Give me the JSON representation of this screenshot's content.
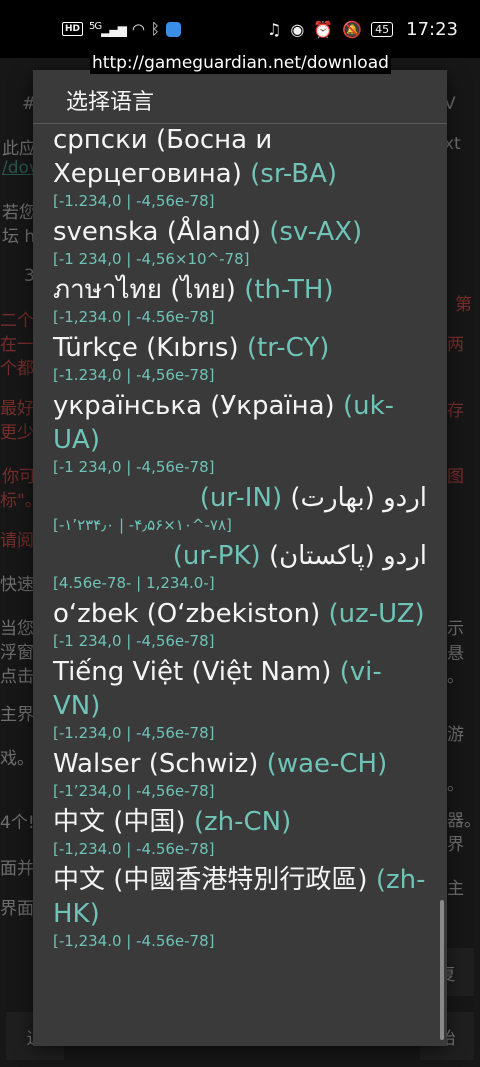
{
  "statusbar": {
    "hd_label": "HD",
    "signal_label": "5G",
    "battery": "45",
    "time": "17:23"
  },
  "toast": {
    "url": "http://gameguardian.net/download"
  },
  "background": {
    "fragments": [
      {
        "text": "#",
        "cls": ""
      },
      {
        "text": "此应",
        "cls": ""
      },
      {
        "text": "/dov",
        "cls": "link"
      },
      {
        "text": "若您",
        "cls": ""
      },
      {
        "text": "坛 h",
        "cls": ""
      },
      {
        "text": "3",
        "cls": ""
      },
      {
        "text": "二个",
        "cls": "red"
      },
      {
        "text": "在一",
        "cls": "red"
      },
      {
        "text": "个都",
        "cls": "red"
      },
      {
        "text": "最好",
        "cls": "red"
      },
      {
        "text": "更少",
        "cls": "red"
      },
      {
        "text": "你可",
        "cls": "red"
      },
      {
        "text": "标\"。",
        "cls": "red"
      },
      {
        "text": "请阅",
        "cls": "red"
      },
      {
        "text": "快速",
        "cls": ""
      },
      {
        "text": "当您",
        "cls": ""
      },
      {
        "text": "浮窗",
        "cls": ""
      },
      {
        "text": "点击",
        "cls": ""
      },
      {
        "text": "主界",
        "cls": ""
      },
      {
        "text": "戏。",
        "cls": ""
      },
      {
        "text": "4个!",
        "cls": ""
      },
      {
        "text": "面并",
        "cls": ""
      },
      {
        "text": "界面",
        "cls": ""
      }
    ],
    "right_fragments": [
      "V",
      "xt",
      "第",
      "两",
      "存",
      "图",
      "示悬",
      "。",
      "游",
      "。",
      "器。",
      "界",
      "主"
    ],
    "btn_left_1": "退",
    "btn_right_1": "复",
    "btn_right_2": "始"
  },
  "dialog": {
    "title": "选择语言",
    "languages": [
      {
        "name": "српски (Босна и Херцеговина)",
        "code": "(sr-BA)",
        "format": "[-1.234,0 | -4,56e-78]",
        "rtl": false
      },
      {
        "name": "svenska (Åland)",
        "code": "(sv-AX)",
        "format": "[-1 234,0 | -4,56×10^-78]",
        "rtl": false
      },
      {
        "name": "ภาษาไทย (ไทย)",
        "code": "(th-TH)",
        "format": "[-1,234.0 | -4.56e-78]",
        "rtl": false
      },
      {
        "name": "Türkçe (Kıbrıs)",
        "code": "(tr-CY)",
        "format": "[-1.234,0 | -4,56e-78]",
        "rtl": false
      },
      {
        "name": "українська (Україна)",
        "code": "(uk-UA)",
        "format": "[-1 234,0 | -4,56e-78]",
        "rtl": false
      },
      {
        "name": "اردو (بھارت)",
        "code": "(ur-IN)",
        "format": "[‎-۱٬۲۳۴٫۰ | ‎-۴٫۵۶×۱۰^‎-۷۸]",
        "rtl": true
      },
      {
        "name": "اردو (پاکستان)",
        "code": "(ur-PK)",
        "format": "[-1,234.0 | -4.56e-78]",
        "rtl": true
      },
      {
        "name": "o‘zbek (O‘zbekiston)",
        "code": "(uz-UZ)",
        "format": "[-1 234,0 | -4,56e-78]",
        "rtl": false
      },
      {
        "name": "Tiếng Việt (Việt Nam)",
        "code": "(vi-VN)",
        "format": "[-1.234,0 | -4,56e-78]",
        "rtl": false
      },
      {
        "name": "Walser (Schwiz)",
        "code": "(wae-CH)",
        "format": "[-1’234,0 | -4,56e-78]",
        "rtl": false
      },
      {
        "name": "中文 (中国)",
        "code": "(zh-CN)",
        "format": "[-1,234.0 | -4.56e-78]",
        "rtl": false
      },
      {
        "name": "中文 (中國香港特別行政區)",
        "code": "(zh-HK)",
        "format": "[-1,234.0 | -4.56e-78]",
        "rtl": false
      }
    ]
  }
}
